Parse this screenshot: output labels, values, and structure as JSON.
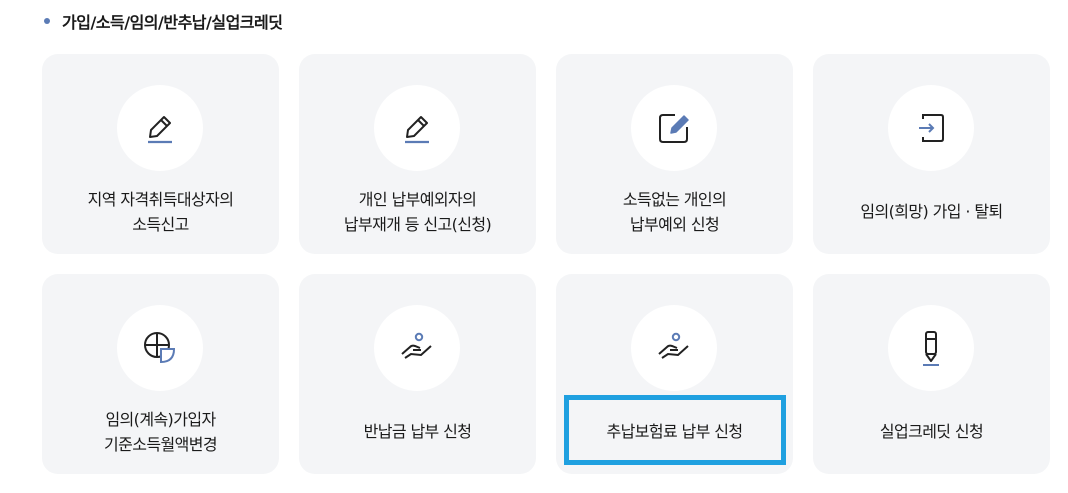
{
  "section": {
    "title": "가입/소득/임의/반추납/실업크레딧"
  },
  "cards": [
    {
      "label": "지역 자격취득대상자의\n소득신고",
      "icon": "pencil-icon"
    },
    {
      "label": "개인 납부예외자의\n납부재개 등 신고(신청)",
      "icon": "pencil-icon"
    },
    {
      "label": "소득없는 개인의\n납부예외 신청",
      "icon": "edit-document-icon"
    },
    {
      "label": "임의(희망) 가입 · 탈퇴",
      "icon": "login-icon"
    },
    {
      "label": "임의(계속)가입자\n기준소득월액변경",
      "icon": "pie-chart-icon"
    },
    {
      "label": "반납금 납부 신청",
      "icon": "hand-person-icon"
    },
    {
      "label": "추납보험료 납부 신청",
      "icon": "hand-person-icon"
    },
    {
      "label": "실업크레딧 신청",
      "icon": "pen-icon"
    }
  ],
  "colors": {
    "accent": "#5b7bb5",
    "card_bg": "#f4f5f7",
    "highlight": "#1fa0e0"
  }
}
